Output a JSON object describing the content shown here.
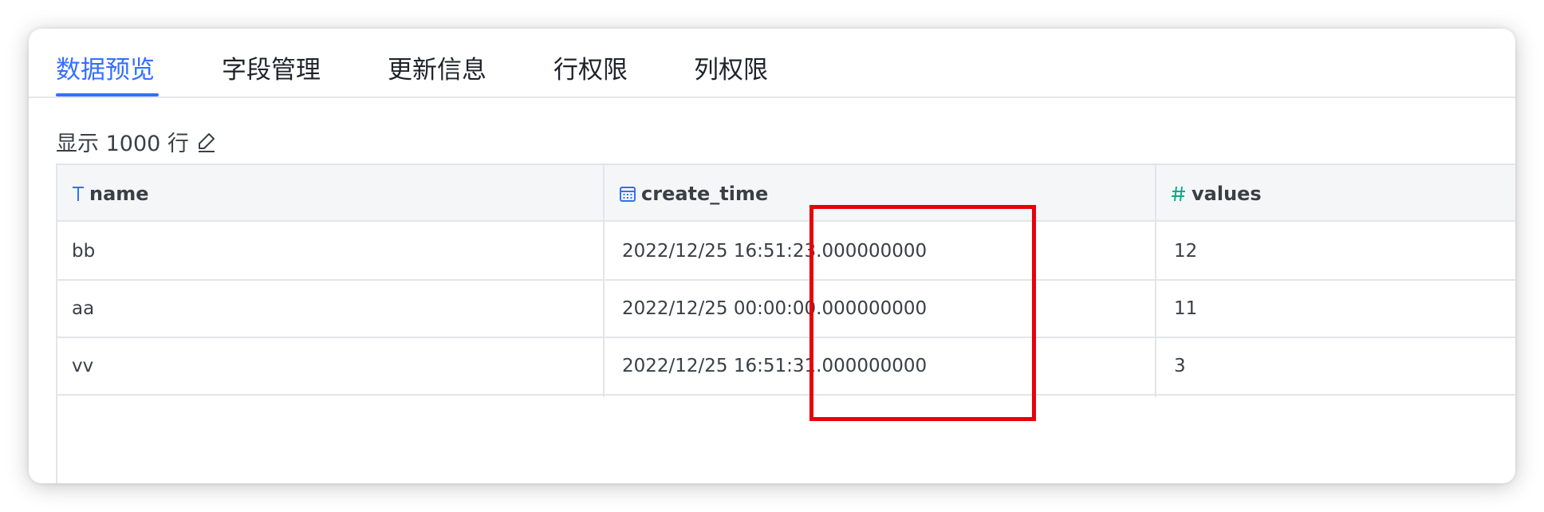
{
  "tabs": [
    {
      "label": "数据预览",
      "active": true
    },
    {
      "label": "字段管理",
      "active": false
    },
    {
      "label": "更新信息",
      "active": false
    },
    {
      "label": "行权限",
      "active": false
    },
    {
      "label": "列权限",
      "active": false
    }
  ],
  "preview": {
    "row_count_label": "显示 1000 行"
  },
  "table": {
    "columns": [
      {
        "name": "name",
        "type_icon": "text-type-icon"
      },
      {
        "name": "create_time",
        "type_icon": "calendar-icon"
      },
      {
        "name": "values",
        "type_icon": "number-type-icon"
      }
    ],
    "rows": [
      [
        "bb",
        "2022/12/25 16:51:23.000000000",
        "12"
      ],
      [
        "aa",
        "2022/12/25 00:00:00.000000000",
        "11"
      ],
      [
        "vv",
        "2022/12/25 16:51:31.000000000",
        "3"
      ]
    ]
  },
  "colors": {
    "accent": "#3370ff",
    "number_icon": "#14a88b",
    "highlight": "#e8000b"
  }
}
